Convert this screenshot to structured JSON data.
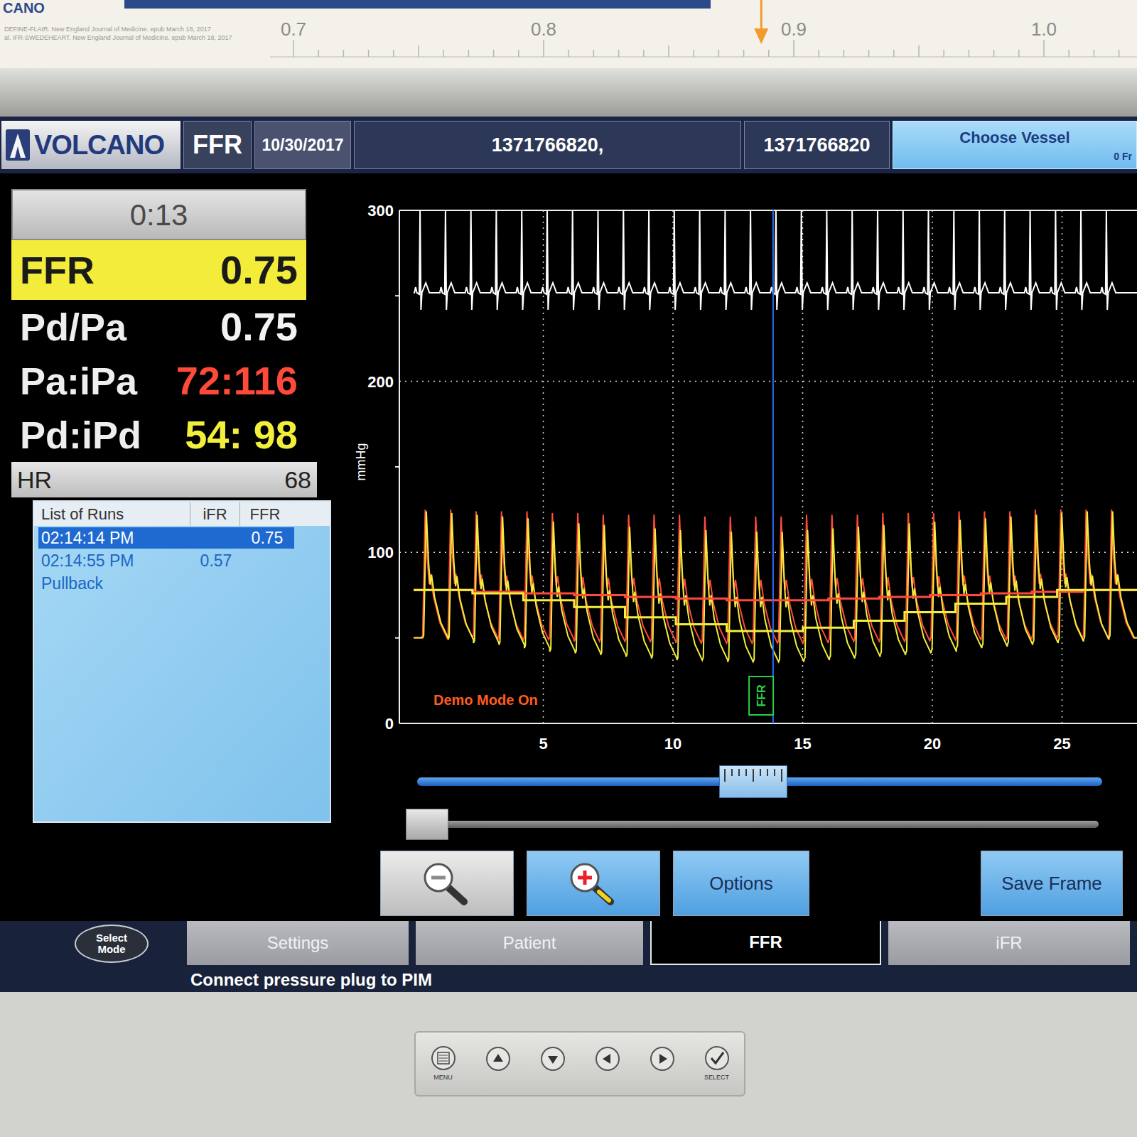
{
  "brochure": {
    "fragment": "CANO",
    "citations": [
      "DEFINE-FLAIR. New England Journal of Medicine. epub March 18, 2017",
      "al. iFR-SWEDEHEART. New England Journal of Medicine. epub March 18, 2017"
    ],
    "ticks": [
      "0.7",
      "0.8",
      "0.9",
      "1.0"
    ],
    "marker": 0.887
  },
  "header": {
    "logo": "VOLCANO",
    "mode": "FFR",
    "date": "10/30/2017",
    "patient_name": "1371766820,",
    "patient_id": "1371766820",
    "vessel_button": "Choose Vessel",
    "frames": "0 Fr"
  },
  "timer": "0:13",
  "readouts": [
    {
      "label": "FFR",
      "value": "0.75",
      "highlighted": true,
      "color": "#1a1a1a"
    },
    {
      "label": "Pd/Pa",
      "value": "0.75",
      "highlighted": false,
      "color": "#f2f2f2"
    },
    {
      "label": "Pa:iPa",
      "value": "72:116",
      "highlighted": false,
      "color": "#ff4a3a"
    },
    {
      "label": "Pd:iPd",
      "value": "54: 98",
      "highlighted": false,
      "color": "#f2ee3c"
    }
  ],
  "heart_rate": {
    "label": "HR",
    "value": "68"
  },
  "runs": {
    "columns": [
      "List of Runs",
      "iFR",
      "FFR"
    ],
    "rows": [
      {
        "name": "02:14:14 PM",
        "ifr": "",
        "ffr": "0.75",
        "selected": true
      },
      {
        "name": "02:14:55 PM",
        "ifr": "0.57",
        "ffr": "",
        "selected": false
      },
      {
        "name": "Pullback",
        "ifr": "",
        "ffr": "",
        "selected": false
      }
    ]
  },
  "chart": {
    "y_unit": "mmHg",
    "y_ticks": [
      "0",
      "100",
      "200",
      "300"
    ],
    "x_ticks": [
      "5",
      "10",
      "15",
      "20",
      "25"
    ],
    "first_beat": 0.45,
    "period": 0.98,
    "cursor": 13.86,
    "marker": {
      "label": "FFR",
      "time": 13.4
    },
    "demo": "Demo Mode On",
    "ecg": {
      "color": "#ffffff"
    },
    "series": [
      {
        "name": "Pa",
        "color": "#ff4a3a",
        "systolic": [
          125,
          125,
          124,
          124,
          124,
          123,
          123,
          122,
          122,
          122,
          122,
          121,
          121,
          121,
          121,
          122,
          122,
          122,
          123,
          123,
          123,
          124,
          124,
          124,
          125,
          125,
          125,
          125
        ],
        "diastolic": [
          50,
          50,
          50,
          49,
          49,
          49,
          48,
          48,
          48,
          48,
          47,
          47,
          47,
          47,
          47,
          47,
          48,
          48,
          48,
          48,
          49,
          49,
          49,
          49,
          50,
          50,
          50,
          50
        ],
        "mean": [
          78,
          78,
          77,
          77,
          76,
          76,
          75,
          75,
          74,
          74,
          73,
          73,
          72,
          72,
          72,
          72,
          73,
          73,
          74,
          74,
          75,
          75,
          76,
          76,
          77,
          77,
          78,
          78
        ]
      },
      {
        "name": "Pd",
        "color": "#f2ee3c",
        "systolic": [
          124,
          123,
          122,
          121,
          120,
          118,
          117,
          116,
          115,
          114,
          113,
          113,
          112,
          112,
          112,
          113,
          114,
          115,
          116,
          117,
          118,
          119,
          120,
          121,
          122,
          123,
          124,
          124
        ],
        "diastolic": [
          50,
          49,
          47,
          46,
          44,
          42,
          41,
          40,
          39,
          38,
          37,
          37,
          36,
          36,
          36,
          37,
          38,
          39,
          40,
          41,
          42,
          44,
          45,
          46,
          47,
          48,
          49,
          50
        ],
        "mean": [
          78,
          78,
          76,
          76,
          72,
          72,
          68,
          68,
          62,
          62,
          58,
          58,
          54,
          54,
          54,
          56,
          56,
          60,
          60,
          65,
          65,
          70,
          70,
          74,
          74,
          78,
          78,
          78
        ]
      }
    ]
  },
  "sliders": [
    {
      "kind": "range",
      "level": 0.49
    },
    {
      "kind": "scroll",
      "level": 0.0
    }
  ],
  "toolbar": {
    "zoom_out_enabled": false,
    "zoom_in_enabled": true,
    "options": "Options",
    "save_frame": "Save Frame"
  },
  "select_mode": [
    "Select",
    "Mode"
  ],
  "tabs": [
    {
      "label": "Settings",
      "selected": false
    },
    {
      "label": "Patient",
      "selected": false
    },
    {
      "label": "FFR",
      "selected": true
    },
    {
      "label": "iFR",
      "selected": false
    }
  ],
  "status": "Connect pressure plug to PIM",
  "monitor": {
    "menu": "MENU",
    "select": "SELECT"
  }
}
